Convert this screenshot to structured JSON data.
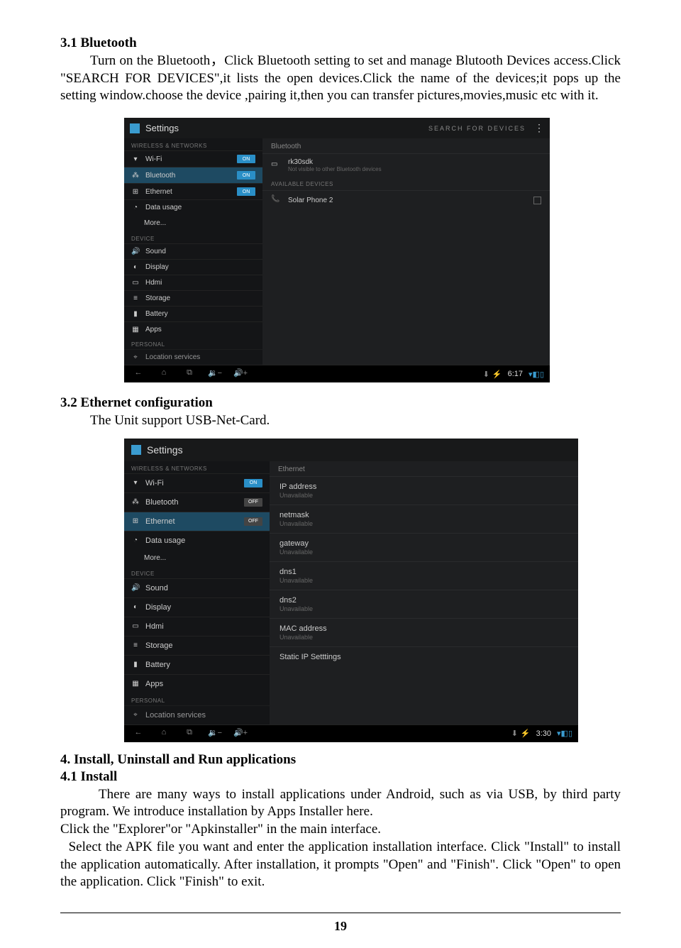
{
  "section31": {
    "title": "3.1 Bluetooth",
    "body": "Turn on the Bluetooth，Click Bluetooth setting to set and manage Blutooth Devices access.Click \"SEARCH FOR DEVICES\",it lists the open devices.Click the name of the devices;it pops up the setting window.choose the device ,pairing it,then you can transfer pictures,movies,music etc with it."
  },
  "shot1": {
    "title": "Settings",
    "search_label": "SEARCH FOR DEVICES",
    "wireless_section": "WIRELESS & NETWORKS",
    "wifi": "Wi-Fi",
    "bluetooth": "Bluetooth",
    "ethernet": "Ethernet",
    "datausage": "Data usage",
    "more": "More...",
    "device_section": "DEVICE",
    "sound": "Sound",
    "display": "Display",
    "hdmi": "Hdmi",
    "storage": "Storage",
    "battery": "Battery",
    "apps": "Apps",
    "personal": "PERSONAL",
    "location": "Location services",
    "on": "ON",
    "off": "OFF",
    "main_title": "Bluetooth",
    "device1": "rk30sdk",
    "device1_sub": "Not visible to other Bluetooth devices",
    "avail": "AVAILABLE DEVICES",
    "device2": "Solar Phone 2",
    "time": "6:17"
  },
  "section32": {
    "title": "3.2 Ethernet configuration",
    "body": "The Unit support USB-Net-Card."
  },
  "shot2": {
    "title": "Settings",
    "wireless_section": "WIRELESS & NETWORKS",
    "wifi": "Wi-Fi",
    "bluetooth": "Bluetooth",
    "ethernet": "Ethernet",
    "datausage": "Data usage",
    "more": "More...",
    "device_section": "DEVICE",
    "sound": "Sound",
    "display": "Display",
    "hdmi": "Hdmi",
    "storage": "Storage",
    "battery": "Battery",
    "apps": "Apps",
    "personal": "PERSONAL",
    "location": "Location services",
    "on": "ON",
    "off": "OFF",
    "main_title": "Ethernet",
    "ip": "IP address",
    "netmask": "netmask",
    "gateway": "gateway",
    "dns1": "dns1",
    "dns2": "dns2",
    "mac": "MAC address",
    "unavail": "Unavailable",
    "staticip": "Static IP Setttings",
    "time": "3:30"
  },
  "section4": {
    "title": "4. Install, Uninstall and Run applications",
    "sub": "4.1 Install",
    "p1": "There are many ways to install applications under Android, such as via USB, by third party program. We introduce installation by Apps Installer here.",
    "p2": "Click the  \"Explorer\"or  \"Apkinstaller\"  in the main interface.",
    "p3": "  Select the APK file you want and enter the application installation interface. Click \"Install\" to install the application automatically. After installation, it prompts \"Open\" and \"Finish\". Click \"Open\" to open the application. Click \"Finish\" to exit."
  },
  "page_number": "19"
}
